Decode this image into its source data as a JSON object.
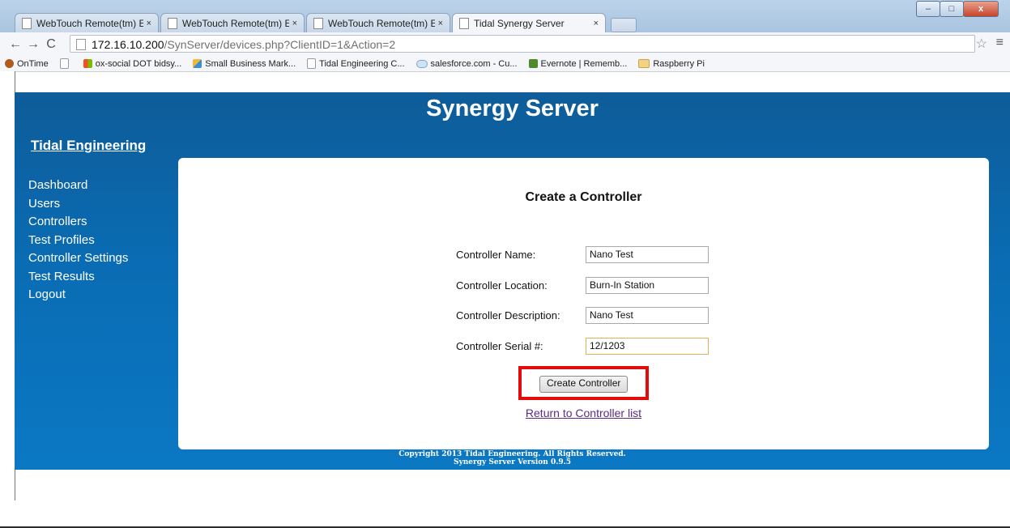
{
  "window": {
    "controls": {
      "minimize": "–",
      "maximize": "□",
      "close": "x"
    }
  },
  "tabs": [
    {
      "label": "WebTouch Remote(tm) E",
      "close": "×",
      "active": false
    },
    {
      "label": "WebTouch Remote(tm) E",
      "close": "×",
      "active": false
    },
    {
      "label": "WebTouch Remote(tm) E",
      "close": "×",
      "active": false
    },
    {
      "label": "Tidal Synergy Server",
      "close": "×",
      "active": true
    }
  ],
  "toolbar": {
    "back": "←",
    "forward": "→",
    "reload": "C",
    "url_host": "172.16.10.200",
    "url_path": "/SynServer/devices.php?ClientID=1&Action=2",
    "star": "☆",
    "menu": "≡"
  },
  "bookmarks": [
    {
      "label": "OnTime",
      "icon": "ontime-icon",
      "color": "#b05a1e"
    },
    {
      "label": "",
      "icon": "page-icon",
      "color": "#ffffff"
    },
    {
      "label": "ox-social DOT bidsy...",
      "icon": "windows-icon",
      "color": "#2aa33a"
    },
    {
      "label": "Small Business Mark...",
      "icon": "chart-icon",
      "color": "#3b8ed6"
    },
    {
      "label": "Tidal Engineering C...",
      "icon": "page-icon",
      "color": "#ffffff"
    },
    {
      "label": "salesforce.com - Cu...",
      "icon": "cloud-icon",
      "color": "#cfe3f3"
    },
    {
      "label": "Evernote | Rememb...",
      "icon": "evernote-icon",
      "color": "#4c8a2a"
    },
    {
      "label": "Raspberry Pi",
      "icon": "folder-icon",
      "color": "#f2d283"
    }
  ],
  "site": {
    "title": "Synergy Server",
    "brand": "Tidal Engineering",
    "nav": [
      "Dashboard",
      "Users",
      "Controllers",
      "Test Profiles",
      "Controller Settings",
      "Test Results",
      "Logout"
    ]
  },
  "form": {
    "heading": "Create a Controller",
    "fields": [
      {
        "label": "Controller Name:",
        "value": "Nano Test"
      },
      {
        "label": "Controller Location:",
        "value": "Burn-In Station"
      },
      {
        "label": "Controller Description:",
        "value": "Nano Test"
      },
      {
        "label": "Controller Serial #:",
        "value": "12/1203"
      }
    ],
    "submit": "Create Controller",
    "return_link": "Return to Controller list"
  },
  "footer": {
    "copyright": "Copyright 2013 Tidal Engineering. All Rights Reserved.",
    "version": "Synergy Server Version 0.9.5"
  },
  "colors": {
    "page_blue": "#0a6cb3",
    "highlight_red": "#e40b0b",
    "link_purple": "#5b2a8a"
  }
}
